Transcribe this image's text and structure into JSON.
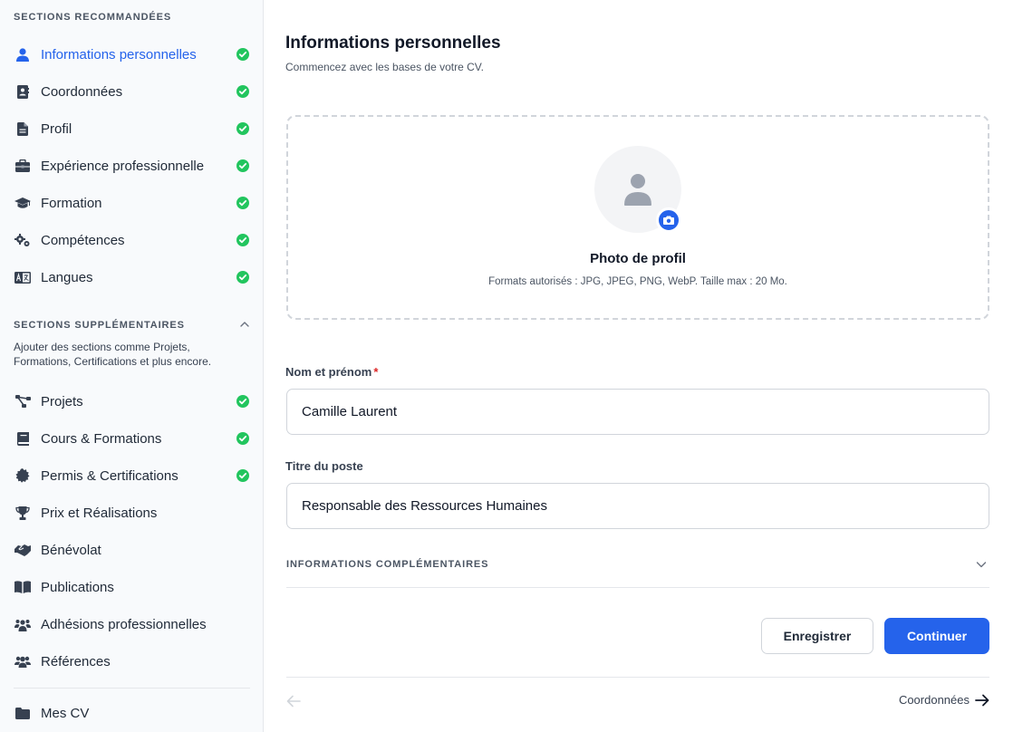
{
  "sidebar": {
    "recommended_heading": "SECTIONS RECOMMANDÉES",
    "supplementary_heading": "SECTIONS SUPPLÉMENTAIRES",
    "supplementary_description": "Ajouter des sections comme Projets, Formations, Certifications et plus encore.",
    "recommended": [
      {
        "label": "Informations personnelles",
        "icon": "user-icon",
        "done": true,
        "active": true
      },
      {
        "label": "Coordonnées",
        "icon": "contact-card-icon",
        "done": true
      },
      {
        "label": "Profil",
        "icon": "document-icon",
        "done": true
      },
      {
        "label": "Expérience professionnelle",
        "icon": "briefcase-icon",
        "done": true
      },
      {
        "label": "Formation",
        "icon": "graduation-cap-icon",
        "done": true
      },
      {
        "label": "Compétences",
        "icon": "gears-icon",
        "done": true
      },
      {
        "label": "Langues",
        "icon": "language-icon",
        "done": true
      }
    ],
    "supplementary": [
      {
        "label": "Projets",
        "icon": "diagram-icon",
        "done": true
      },
      {
        "label": "Cours & Formations",
        "icon": "book-icon",
        "done": true
      },
      {
        "label": "Permis & Certifications",
        "icon": "certificate-icon",
        "done": true
      },
      {
        "label": "Prix et Réalisations",
        "icon": "trophy-icon",
        "done": false
      },
      {
        "label": "Bénévolat",
        "icon": "handshake-icon",
        "done": false
      },
      {
        "label": "Publications",
        "icon": "open-book-icon",
        "done": false
      },
      {
        "label": "Adhésions professionnelles",
        "icon": "people-group-icon",
        "done": false
      },
      {
        "label": "Références",
        "icon": "users-icon",
        "done": false
      }
    ],
    "my_cv": {
      "label": "Mes CV",
      "icon": "folder-icon"
    }
  },
  "main": {
    "title": "Informations personnelles",
    "subtitle": "Commencez avec les bases de votre CV.",
    "photo": {
      "title": "Photo de profil",
      "formats": "Formats autorisés : JPG, JPEG, PNG, WebP. Taille max : 20 Mo."
    },
    "name_field": {
      "label": "Nom et prénom",
      "required_mark": "*",
      "value": "Camille Laurent"
    },
    "job_field": {
      "label": "Titre du poste",
      "value": "Responsable des Ressources Humaines"
    },
    "extra_section": "INFORMATIONS COMPLÉMENTAIRES",
    "save_label": "Enregistrer",
    "continue_label": "Continuer",
    "next_label": "Coordonnées"
  },
  "colors": {
    "accent": "#2563eb",
    "success": "#22c55e",
    "required": "#dc2626"
  }
}
